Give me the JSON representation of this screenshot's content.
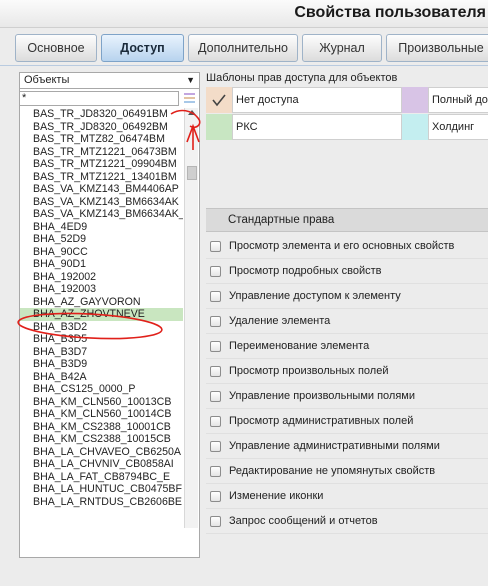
{
  "window": {
    "title": "Свойства пользователя"
  },
  "tabs": [
    {
      "label": "Основное"
    },
    {
      "label": "Доступ"
    },
    {
      "label": "Дополнительно"
    },
    {
      "label": "Журнал"
    },
    {
      "label": "Произвольные"
    }
  ],
  "left": {
    "type_select": "Объекты",
    "filter_value": "*",
    "items": [
      "BAS_TR_JD8320_06491BM",
      "BAS_TR_JD8320_06492BM",
      "BAS_TR_MTZ82_06474BM",
      "BAS_TR_MTZ1221_06473BM",
      "BAS_TR_MTZ1221_09904BM",
      "BAS_TR_MTZ1221_13401BM",
      "BAS_VA_KMZ143_BM4406AP",
      "BAS_VA_KMZ143_BM6634AK",
      "BAS_VA_KMZ143_BM6634AK_",
      "BHA_4ED9",
      "BHA_52D9",
      "BHA_90CC",
      "BHA_90D1",
      "BHA_192002",
      "BHA_192003",
      "BHA_AZ_GAYVORON",
      "BHA_AZ_ZHOVTNEVE",
      "BHA_B3D2",
      "BHA_B3D5",
      "BHA_B3D7",
      "BHA_B3D9",
      "BHA_B42A",
      "BHA_CS125_0000_P",
      "BHA_KM_CLN560_10013CB",
      "BHA_KM_CLN560_10014CB",
      "BHA_KM_CS2388_10001CB",
      "BHA_KM_CS2388_10015CB",
      "BHA_LA_CHVAVEO_CB6250A",
      "BHA_LA_CHVNIV_CB0858AI",
      "BHA_LA_FAT_CB8794BC_E",
      "BHA_LA_HUNTUC_CB0475BF",
      "BHA_LA_RNTDUS_CB2606BE"
    ],
    "selected_index": 16
  },
  "templates": {
    "label": "Шаблоны прав доступа для объектов",
    "rows": [
      [
        {
          "name": "Нет доступа",
          "color": "#f3dcc8",
          "checked": true
        },
        {
          "name": "Полный доступ",
          "color": "#d8c4e6",
          "checked": false
        }
      ],
      [
        {
          "name": "РКС",
          "color": "#c8e6c2",
          "checked": false
        },
        {
          "name": "Холдинг",
          "color": "#c4eef0",
          "checked": false
        }
      ]
    ]
  },
  "rights": {
    "header": "Стандартные права",
    "items": [
      "Просмотр элемента и его основных свойств",
      "Просмотр подробных свойств",
      "Управление доступом к элементу",
      "Удаление элемента",
      "Переименование элемента",
      "Просмотр произвольных полей",
      "Управление произвольными полями",
      "Просмотр административных полей",
      "Управление административными полями",
      "Редактирование не упомянутых свойств",
      "Изменение иконки",
      "Запрос сообщений и отчетов"
    ]
  },
  "colors": {
    "accent_tab": "#b7d3ee",
    "selection": "#c9e6c0",
    "annotation": "#e0201a",
    "filter_icon": [
      "#c3a6e0",
      "#e3c3a3",
      "#a8c8e8"
    ]
  }
}
